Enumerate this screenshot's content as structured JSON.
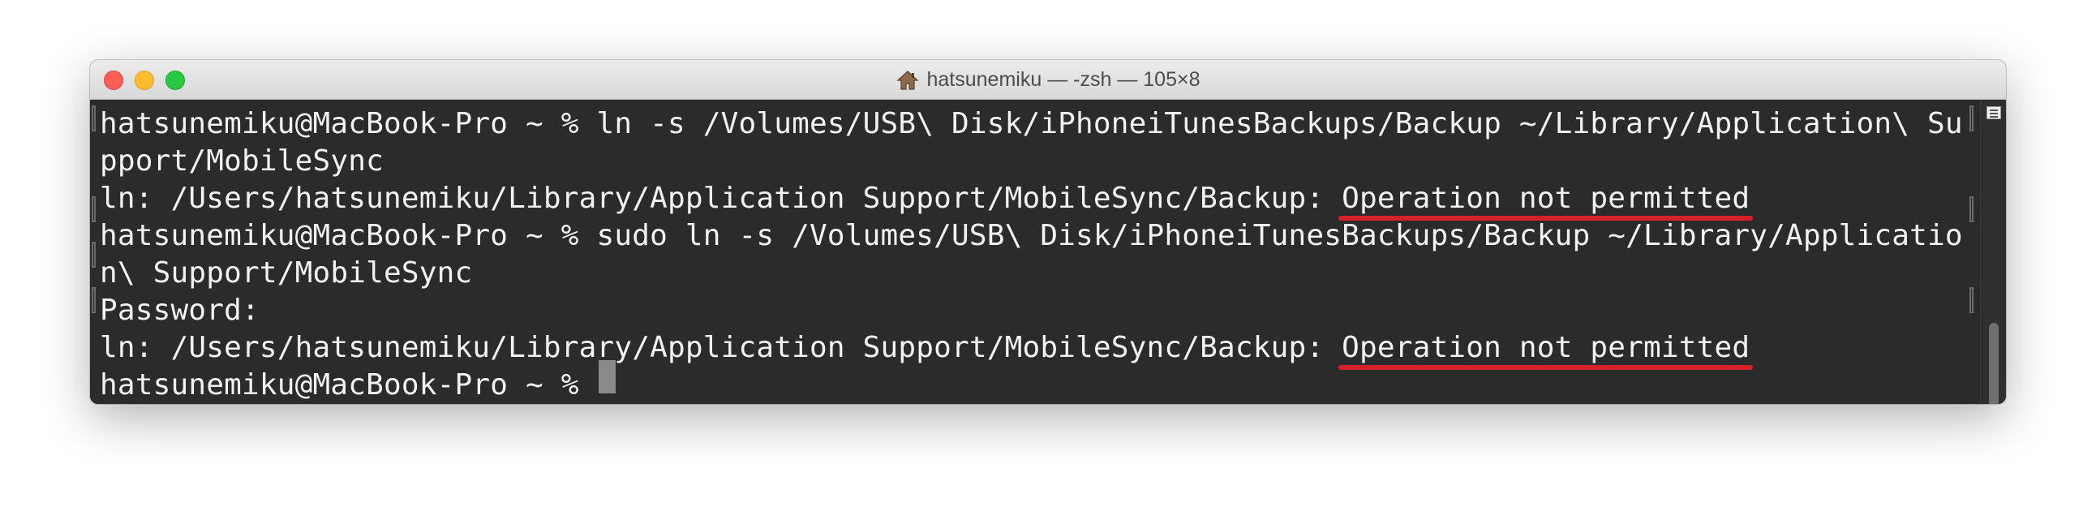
{
  "window": {
    "title": "hatsunemiku — -zsh — 105×8",
    "title_icon": "home-icon"
  },
  "terminal": {
    "lines": [
      "hatsunemiku@MacBook-Pro ~ % ln -s /Volumes/USB\\ Disk/iPhoneiTunesBackups/Backup ~/Library/Application\\ Su",
      "pport/MobileSync",
      "ln: /Users/hatsunemiku/Library/Application Support/MobileSync/Backup: ",
      "hatsunemiku@MacBook-Pro ~ % sudo ln -s /Volumes/USB\\ Disk/iPhoneiTunesBackups/Backup ~/Library/Applicatio",
      "n\\ Support/MobileSync",
      "Password:",
      "ln: /Users/hatsunemiku/Library/Application Support/MobileSync/Backup: ",
      "hatsunemiku@MacBook-Pro ~ % "
    ],
    "error_text": "Operation not permitted"
  },
  "colors": {
    "background": "#2b2b2b",
    "text": "#f2f2f2",
    "underline": "#d6202a",
    "close": "#fd5e57",
    "minimize": "#febc2e",
    "zoom": "#28c840"
  }
}
